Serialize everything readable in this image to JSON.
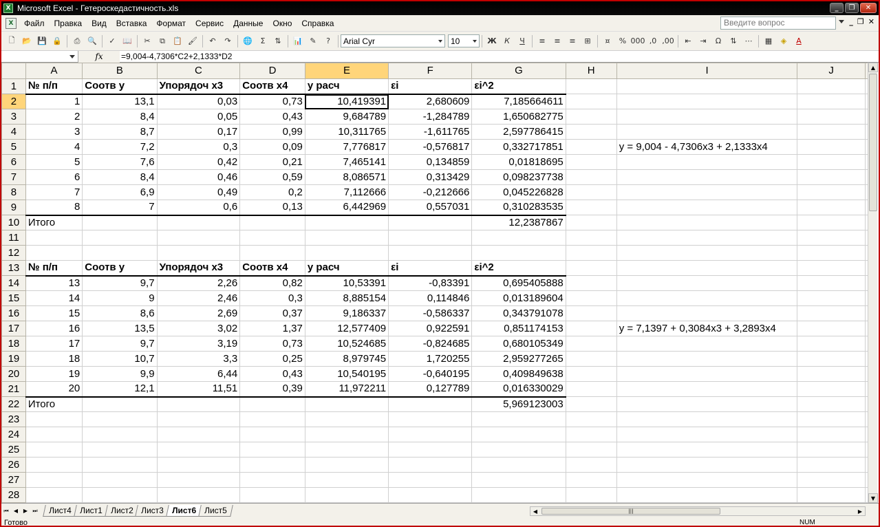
{
  "window": {
    "title": "Microsoft Excel - Гетероскедастичность.xls",
    "app_icon": "excel-icon"
  },
  "menu": [
    "Файл",
    "Правка",
    "Вид",
    "Вставка",
    "Формат",
    "Сервис",
    "Данные",
    "Окно",
    "Справка"
  ],
  "ask_placeholder": "Введите вопрос",
  "toolbar": {
    "font_name": "Arial Cyr",
    "font_size": "10"
  },
  "formula_bar": {
    "name_box": "",
    "fx": "fx",
    "formula": "=9,004-4,7306*C2+2,1333*D2"
  },
  "columns": [
    "A",
    "B",
    "C",
    "D",
    "E",
    "F",
    "G",
    "H",
    "I",
    "J"
  ],
  "selected_cell": "E2",
  "rows": [
    {
      "n": "1",
      "c": [
        "№ п/п",
        "Соотв y",
        "Упорядоч x3",
        "Соотв x4",
        "y расч",
        "εi",
        "εi^2",
        "",
        "",
        ""
      ]
    },
    {
      "n": "2",
      "c": [
        "1",
        "13,1",
        "0,03",
        "0,73",
        "10,419391",
        "2,680609",
        "7,185664611",
        "",
        "",
        ""
      ]
    },
    {
      "n": "3",
      "c": [
        "2",
        "8,4",
        "0,05",
        "0,43",
        "9,684789",
        "-1,284789",
        "1,650682775",
        "",
        "",
        ""
      ]
    },
    {
      "n": "4",
      "c": [
        "3",
        "8,7",
        "0,17",
        "0,99",
        "10,311765",
        "-1,611765",
        "2,597786415",
        "",
        "",
        ""
      ]
    },
    {
      "n": "5",
      "c": [
        "4",
        "7,2",
        "0,3",
        "0,09",
        "7,776817",
        "-0,576817",
        "0,332717851",
        "",
        "y = 9,004 - 4,7306x3 + 2,1333x4",
        ""
      ]
    },
    {
      "n": "6",
      "c": [
        "5",
        "7,6",
        "0,42",
        "0,21",
        "7,465141",
        "0,134859",
        "0,01818695",
        "",
        "",
        ""
      ]
    },
    {
      "n": "7",
      "c": [
        "6",
        "8,4",
        "0,46",
        "0,59",
        "8,086571",
        "0,313429",
        "0,098237738",
        "",
        "",
        ""
      ]
    },
    {
      "n": "8",
      "c": [
        "7",
        "6,9",
        "0,49",
        "0,2",
        "7,112666",
        "-0,212666",
        "0,045226828",
        "",
        "",
        ""
      ]
    },
    {
      "n": "9",
      "c": [
        "8",
        "7",
        "0,6",
        "0,13",
        "6,442969",
        "0,557031",
        "0,310283535",
        "",
        "",
        ""
      ]
    },
    {
      "n": "10",
      "c": [
        "Итого",
        "",
        "",
        "",
        "",
        "",
        "12,2387867",
        "",
        "",
        ""
      ]
    },
    {
      "n": "11",
      "c": [
        "",
        "",
        "",
        "",
        "",
        "",
        "",
        "",
        "",
        ""
      ]
    },
    {
      "n": "12",
      "c": [
        "",
        "",
        "",
        "",
        "",
        "",
        "",
        "",
        "",
        ""
      ]
    },
    {
      "n": "13",
      "c": [
        "№ п/п",
        "Соотв y",
        "Упорядоч x3",
        "Соотв x4",
        "y расч",
        "εi",
        "εi^2",
        "",
        "",
        ""
      ]
    },
    {
      "n": "14",
      "c": [
        "13",
        "9,7",
        "2,26",
        "0,82",
        "10,53391",
        "-0,83391",
        "0,695405888",
        "",
        "",
        ""
      ]
    },
    {
      "n": "15",
      "c": [
        "14",
        "9",
        "2,46",
        "0,3",
        "8,885154",
        "0,114846",
        "0,013189604",
        "",
        "",
        ""
      ]
    },
    {
      "n": "16",
      "c": [
        "15",
        "8,6",
        "2,69",
        "0,37",
        "9,186337",
        "-0,586337",
        "0,343791078",
        "",
        "",
        ""
      ]
    },
    {
      "n": "17",
      "c": [
        "16",
        "13,5",
        "3,02",
        "1,37",
        "12,577409",
        "0,922591",
        "0,851174153",
        "",
        "y = 7,1397 + 0,3084x3 + 3,2893x4",
        ""
      ]
    },
    {
      "n": "18",
      "c": [
        "17",
        "9,7",
        "3,19",
        "0,73",
        "10,524685",
        "-0,824685",
        "0,680105349",
        "",
        "",
        ""
      ]
    },
    {
      "n": "19",
      "c": [
        "18",
        "10,7",
        "3,3",
        "0,25",
        "8,979745",
        "1,720255",
        "2,959277265",
        "",
        "",
        ""
      ]
    },
    {
      "n": "20",
      "c": [
        "19",
        "9,9",
        "6,44",
        "0,43",
        "10,540195",
        "-0,640195",
        "0,409849638",
        "",
        "",
        ""
      ]
    },
    {
      "n": "21",
      "c": [
        "20",
        "12,1",
        "11,51",
        "0,39",
        "11,972211",
        "0,127789",
        "0,016330029",
        "",
        "",
        ""
      ]
    },
    {
      "n": "22",
      "c": [
        "Итого",
        "",
        "",
        "",
        "",
        "",
        "5,969123003",
        "",
        "",
        ""
      ]
    },
    {
      "n": "23",
      "c": [
        "",
        "",
        "",
        "",
        "",
        "",
        "",
        "",
        "",
        ""
      ]
    },
    {
      "n": "24",
      "c": [
        "",
        "",
        "",
        "",
        "",
        "",
        "",
        "",
        "",
        ""
      ]
    },
    {
      "n": "25",
      "c": [
        "",
        "",
        "",
        "",
        "",
        "",
        "",
        "",
        "",
        ""
      ]
    },
    {
      "n": "26",
      "c": [
        "",
        "",
        "",
        "",
        "",
        "",
        "",
        "",
        "",
        ""
      ]
    },
    {
      "n": "27",
      "c": [
        "",
        "",
        "",
        "",
        "",
        "",
        "",
        "",
        "",
        ""
      ]
    },
    {
      "n": "28",
      "c": [
        "",
        "",
        "",
        "",
        "",
        "",
        "",
        "",
        "",
        ""
      ]
    }
  ],
  "sheet_tabs": [
    "Лист4",
    "Лист1",
    "Лист2",
    "Лист3",
    "Лист6",
    "Лист5"
  ],
  "active_tab": "Лист6",
  "status": {
    "left": "Готово",
    "num": "NUM"
  }
}
